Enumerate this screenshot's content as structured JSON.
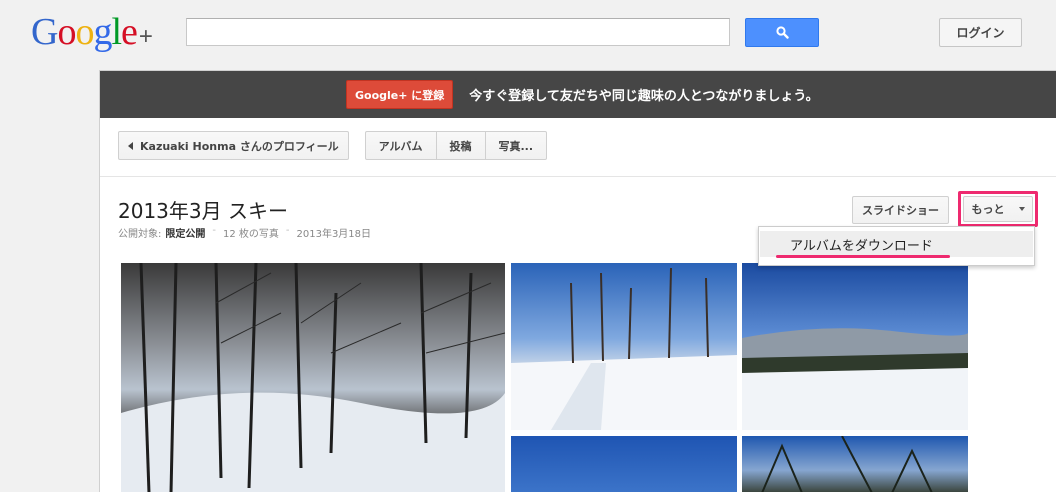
{
  "header": {
    "logo_letters": [
      {
        "char": "G",
        "color": "#3366cc"
      },
      {
        "char": "o",
        "color": "#d50f25"
      },
      {
        "char": "o",
        "color": "#eeb211"
      },
      {
        "char": "g",
        "color": "#3369e8"
      },
      {
        "char": "l",
        "color": "#009925"
      },
      {
        "char": "e",
        "color": "#d50f25"
      }
    ],
    "logo_plus": "+",
    "search_value": "",
    "search_icon": "search-icon",
    "login_label": "ログイン"
  },
  "banner": {
    "signup_label": "Google+ に登録",
    "message": "今すぐ登録して友だちや同じ趣味の人とつながりましょう。"
  },
  "nav": {
    "back_label": "Kazuaki Honma さんのプロフィール",
    "tabs": [
      "アルバム",
      "投稿",
      "写真..."
    ]
  },
  "album": {
    "title": "2013年3月 スキー",
    "visibility_prefix": "公開対象:",
    "visibility_value": "限定公開",
    "photo_count": "12 枚の写真",
    "date": "2013年3月18日"
  },
  "actions": {
    "slideshow_label": "スライドショー",
    "more_label": "もっと",
    "menu_items": [
      "アルバムをダウンロード"
    ]
  },
  "colors": {
    "accent_blue": "#4d90fe",
    "signup_red": "#dd4b39",
    "highlight_pink": "#ee2a6f",
    "banner_dark": "#464646"
  }
}
